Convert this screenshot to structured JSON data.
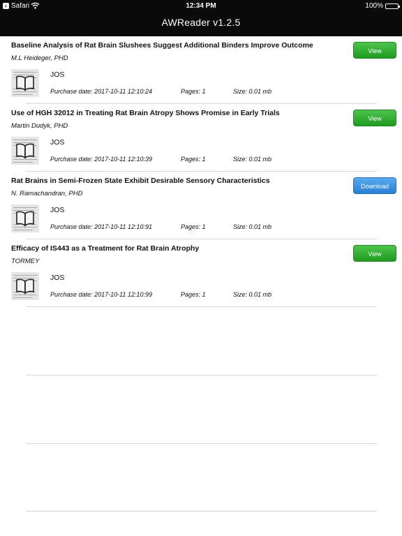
{
  "status_bar": {
    "back_app": "Safari",
    "time": "12:34 PM",
    "battery": "100%"
  },
  "header": {
    "title": "AWReader v1.2.5"
  },
  "labels": {
    "purchase_date": "Purchase date:",
    "pages": "Pages:",
    "size": "Size:"
  },
  "documents": [
    {
      "title": "Baseline Analysis of Rat Brain Slushees Suggest Additional Binders Improve Outcome",
      "author": "M.L Heideger, PHD",
      "journal": "JOS",
      "purchase_date": "2017-10-11 12:10:24",
      "pages": "1",
      "size": "0.01 mb",
      "action": "View",
      "action_color": "#2aa52a"
    },
    {
      "title": "Use of HGH 32012 in Treating Rat Brain Atropy Shows Promise in Early Trials",
      "author": "Martin Dudyk, PHD",
      "journal": "JOS",
      "purchase_date": "2017-10-11 12:10:39",
      "pages": "1",
      "size": "0.01 mb",
      "action": "View",
      "action_color": "#2aa52a"
    },
    {
      "title": "Rat Brains in Semi-Frozen State Exhibit Desirable Sensory Characteristics",
      "author": "N. Ramachandran, PHD",
      "journal": "JOS",
      "purchase_date": "2017-10-11 12:10:91",
      "pages": "1",
      "size": "0.01 mb",
      "action": "Download",
      "action_color": "#3a8ee0"
    },
    {
      "title": "Efficacy of IS443 as a Treatment for Rat Brain Atrophy",
      "author": "TORMEY",
      "journal": "JOS",
      "purchase_date": "2017-10-11 12:10:99",
      "pages": "1",
      "size": "0.01 mb",
      "action": "View",
      "action_color": "#2aa52a"
    }
  ]
}
